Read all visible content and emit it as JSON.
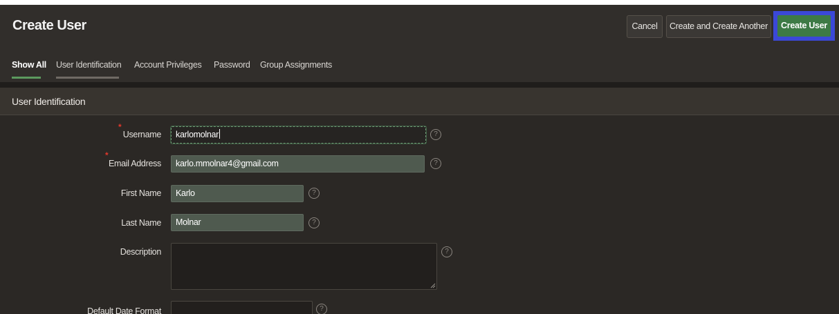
{
  "header": {
    "title": "Create User",
    "cancel_label": "Cancel",
    "create_another_label": "Create and Create Another",
    "create_label": "Create User"
  },
  "tabs": [
    {
      "label": "Show All",
      "active": true
    },
    {
      "label": "User Identification",
      "active": false
    },
    {
      "label": "Account Privileges",
      "active": false
    },
    {
      "label": "Password",
      "active": false
    },
    {
      "label": "Group Assignments",
      "active": false
    }
  ],
  "section": {
    "title": "User Identification"
  },
  "form": {
    "username": {
      "label": "Username",
      "value": "karlomolnar",
      "required": true
    },
    "email": {
      "label": "Email Address",
      "value": "karlo.mmolnar4@gmail.com",
      "required": true
    },
    "first_name": {
      "label": "First Name",
      "value": "Karlo"
    },
    "last_name": {
      "label": "Last Name",
      "value": "Molnar"
    },
    "description": {
      "label": "Description",
      "value": ""
    },
    "date_format": {
      "label": "Default Date Format",
      "value": ""
    },
    "required_marker": "*",
    "help_icon_glyph": "?"
  },
  "colors": {
    "accent_green": "#3d7a45",
    "focus_outline": "#3b48d8",
    "required": "#e2382c"
  }
}
